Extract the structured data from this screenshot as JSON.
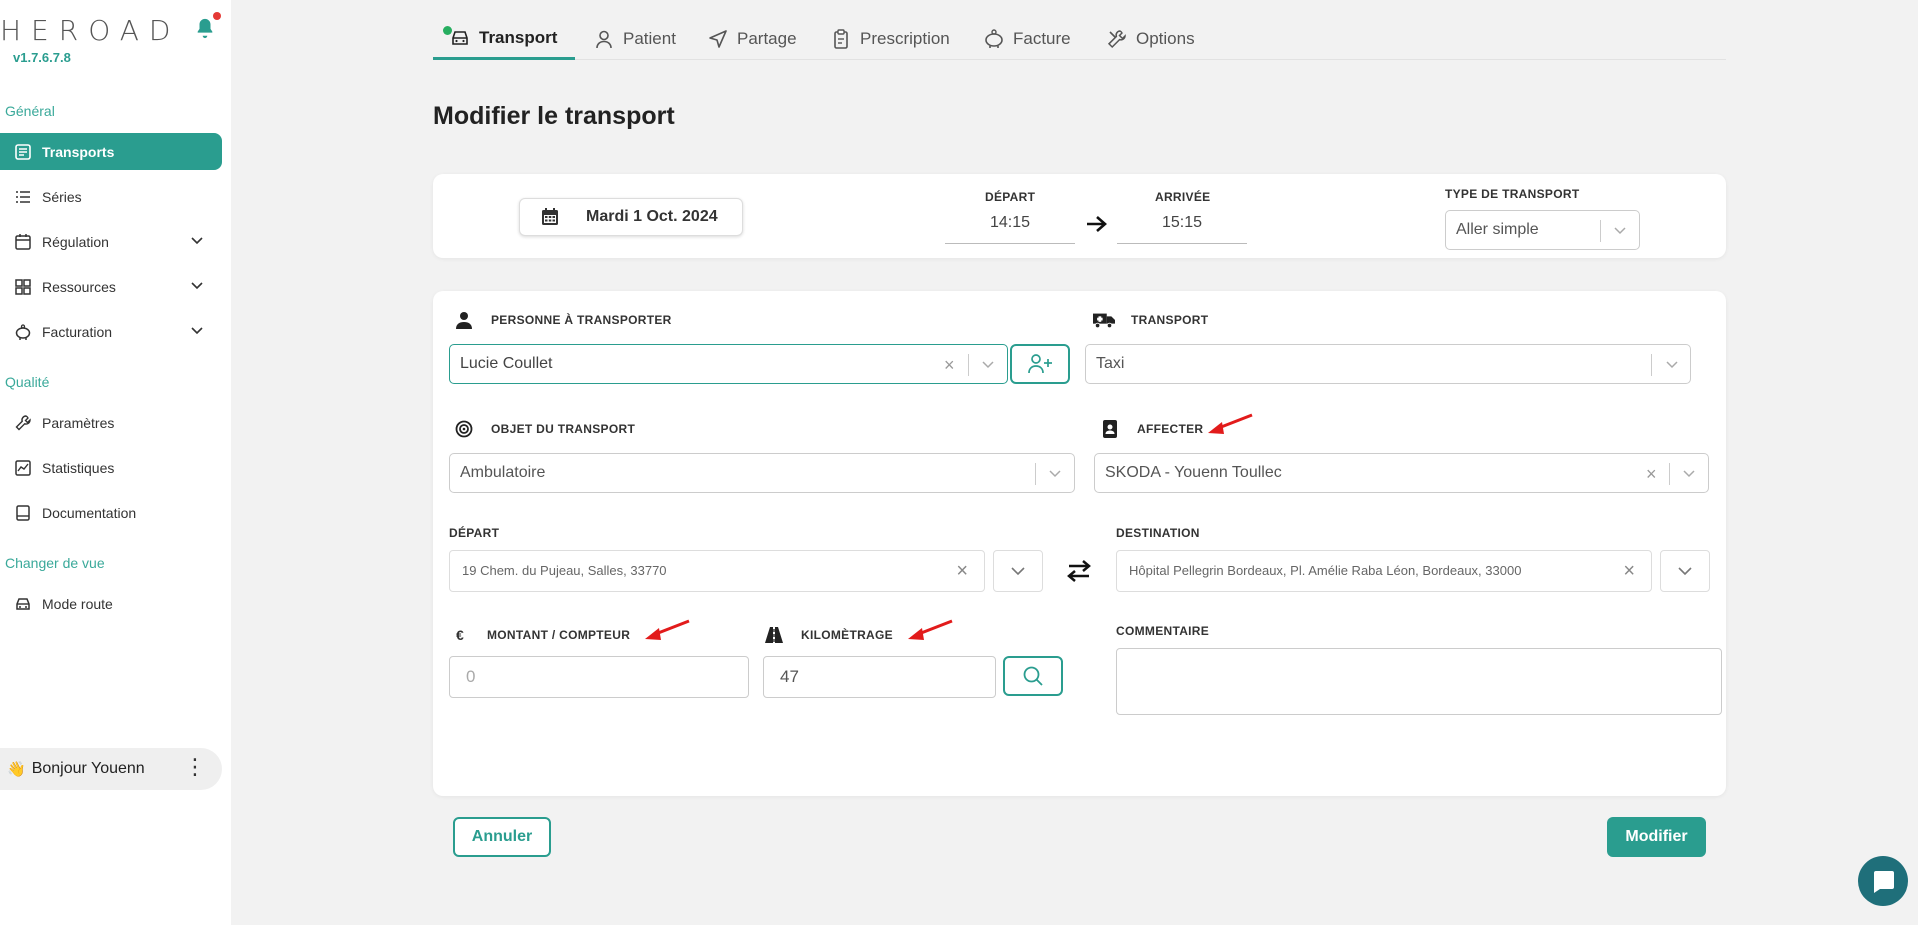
{
  "app": {
    "logo_text": "HEROAD",
    "version": "v1.7.6.7.8"
  },
  "sidebar": {
    "sections": {
      "general": "Général",
      "qualite": "Qualité",
      "changer_vue": "Changer de vue"
    },
    "items": [
      {
        "label": "Transports",
        "icon": "list-icon",
        "active": true
      },
      {
        "label": "Séries",
        "icon": "bullet-list-icon"
      },
      {
        "label": "Régulation",
        "icon": "calendar-icon",
        "expandable": true
      },
      {
        "label": "Ressources",
        "icon": "grid-icon",
        "expandable": true
      },
      {
        "label": "Facturation",
        "icon": "piggy-bank-icon",
        "expandable": true
      },
      {
        "label": "Paramètres",
        "icon": "wrench-icon"
      },
      {
        "label": "Statistiques",
        "icon": "stats-icon"
      },
      {
        "label": "Documentation",
        "icon": "book-icon"
      },
      {
        "label": "Mode route",
        "icon": "car-icon"
      }
    ],
    "user_greeting": "Bonjour Youenn"
  },
  "tabs": [
    {
      "label": "Transport",
      "icon": "car-icon",
      "active": true
    },
    {
      "label": "Patient",
      "icon": "user-icon"
    },
    {
      "label": "Partage",
      "icon": "send-icon"
    },
    {
      "label": "Prescription",
      "icon": "clipboard-icon"
    },
    {
      "label": "Facture",
      "icon": "piggy-bank-icon"
    },
    {
      "label": "Options",
      "icon": "tools-icon"
    }
  ],
  "page": {
    "title": "Modifier le transport"
  },
  "schedule": {
    "date": "Mardi 1 Oct. 2024",
    "depart_label": "DÉPART",
    "depart_time": "14:15",
    "arrivee_label": "ARRIVÉE",
    "arrivee_time": "15:15",
    "type_label": "TYPE DE TRANSPORT",
    "type_value": "Aller simple"
  },
  "form": {
    "personne_label": "PERSONNE À TRANSPORTER",
    "personne_value": "Lucie Coullet",
    "transport_label": "TRANSPORT",
    "transport_value": "Taxi",
    "objet_label": "OBJET DU TRANSPORT",
    "objet_value": "Ambulatoire",
    "affecter_label": "AFFECTER",
    "affecter_value": "SKODA - Youenn Toullec",
    "depart_label": "DÉPART",
    "depart_address": "19 Chem. du Pujeau, Salles, 33770",
    "destination_label": "DESTINATION",
    "destination_address": "Hôpital Pellegrin Bordeaux,  Pl. Amélie Raba Léon, Bordeaux, 33000",
    "montant_label": "MONTANT / COMPTEUR",
    "montant_placeholder": "0",
    "km_label": "KILOMÈTRAGE",
    "km_value": "47",
    "commentaire_label": "COMMENTAIRE",
    "currency_symbol": "€"
  },
  "actions": {
    "cancel": "Annuler",
    "submit": "Modifier"
  },
  "colors": {
    "accent": "#2a9d8f",
    "annotation_arrow": "#e21b1b"
  }
}
